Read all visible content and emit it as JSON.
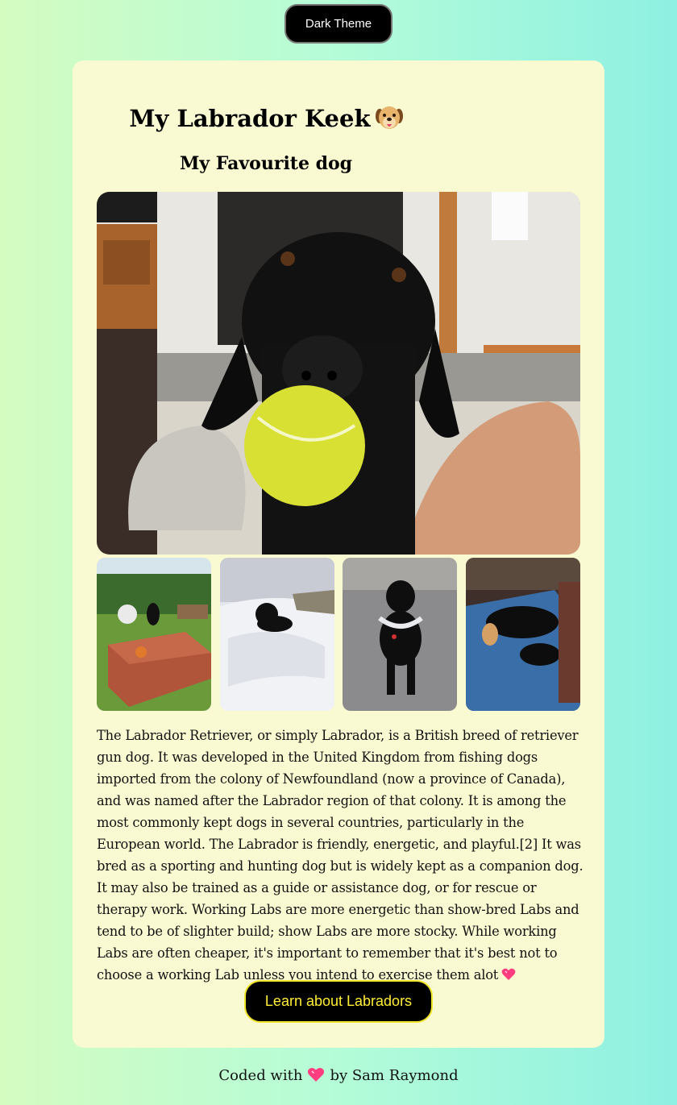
{
  "theme_toggle": {
    "label": "Dark Theme"
  },
  "card": {
    "title": "My Labrador Keek",
    "title_emoji": "dog-face-icon",
    "subtitle": "My Favourite dog",
    "main_image_alt": "black labrador holding tennis ball",
    "thumbnails": [
      {
        "alt": "labrador on show jump platform"
      },
      {
        "alt": "labrador in snow"
      },
      {
        "alt": "labrador with tinsel"
      },
      {
        "alt": "labrador sleeping on blue bed"
      }
    ],
    "description": "The Labrador Retriever, or simply Labrador, is a British breed of retriever gun dog. It was developed in the United Kingdom from fishing dogs imported from the colony of Newfoundland (now a province of Canada), and was named after the Labrador region of that colony. It is among the most commonly kept dogs in several countries, particularly in the European world. The Labrador is friendly, energetic, and playful.[2] It was bred as a sporting and hunting dog but is widely kept as a companion dog. It may also be trained as a guide or assistance dog, or for rescue or therapy work. Working Labs are more energetic than show-bred Labs and tend to be of slighter build; show Labs are more stocky. While working Labs are often cheaper, it's important to remember that it's best not to choose a working Lab unless you intend to exercise them alot",
    "cta_label": "Learn about Labradors"
  },
  "footer": {
    "prefix": "Coded with",
    "suffix": "by Sam Raymond",
    "icon": "heart-icon"
  },
  "colors": {
    "card_bg": "#fafad2",
    "button_bg": "#000000",
    "cta_text": "#ffee33",
    "heart": "#ff3d7f"
  }
}
